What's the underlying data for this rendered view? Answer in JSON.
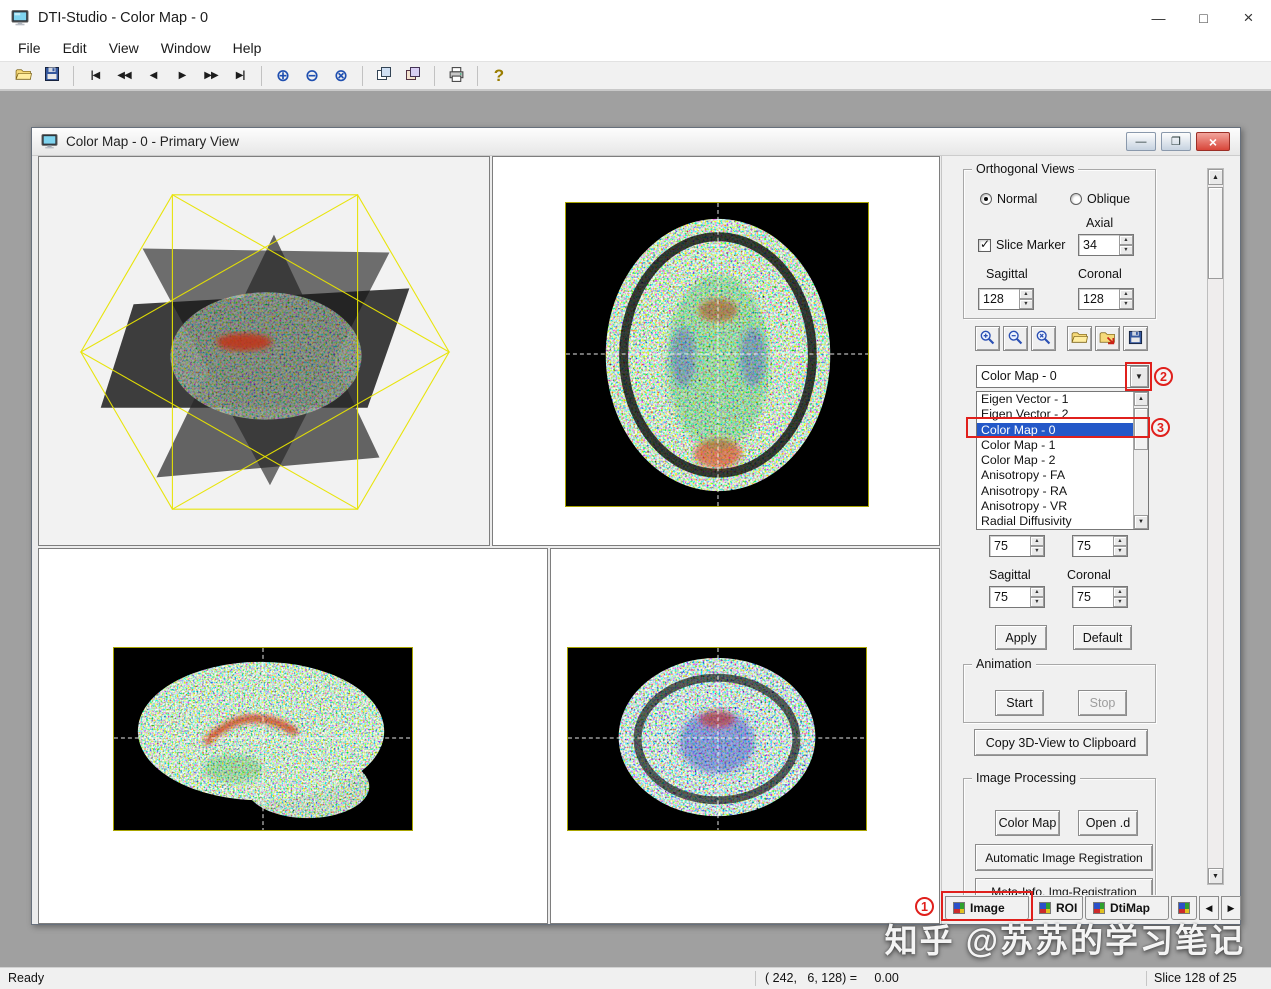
{
  "window": {
    "title": "DTI-Studio -  Color Map - 0",
    "controls": {
      "minimize": "—",
      "maximize": "□",
      "close": "×"
    }
  },
  "menu": {
    "items": [
      "File",
      "Edit",
      "View",
      "Window",
      "Help"
    ]
  },
  "child_window": {
    "title": "Color Map - 0 - Primary View",
    "controls": {
      "minimize": "—",
      "maximize": "❐",
      "close": "×"
    }
  },
  "panel": {
    "orthogonal": {
      "label": "Orthogonal Views",
      "normal": "Normal",
      "oblique": "Oblique",
      "axial_label": "Axial",
      "slice_marker": "Slice Marker",
      "axial_value": "34",
      "sagittal_label": "Sagittal",
      "coronal_label": "Coronal",
      "sagittal_value": "128",
      "coronal_value": "128"
    },
    "combo": {
      "value": "Color Map - 0"
    },
    "list": {
      "items": [
        "Eigen Vector - 1",
        "Eigen Vector - 2",
        "Color Map - 0",
        "Color Map - 1",
        "Color Map - 2",
        "Anisotropy - FA",
        "Anisotropy - RA",
        "Anisotropy - VR",
        "Radial Diffusivity"
      ],
      "selected_index": 2
    },
    "zoom": {
      "axial_a": "75",
      "axial_b": "75",
      "sagittal_label": "Sagittal",
      "coronal_label": "Coronal",
      "sagittal_value": "75",
      "coronal_value": "75",
      "apply": "Apply",
      "default": "Default"
    },
    "animation": {
      "label": "Animation",
      "start": "Start",
      "stop": "Stop"
    },
    "copy_3d": "Copy 3D-View to Clipboard",
    "image_processing": {
      "label": "Image Processing",
      "color_map": "Color Map",
      "open_d": "Open .d",
      "auto_registration": "Automatic Image Registration",
      "meta_info": "Meta-Info, Img-Registration"
    }
  },
  "tabs": {
    "items": [
      "Image",
      "ROI",
      "DtiMap"
    ]
  },
  "status": {
    "ready": "Ready",
    "coords": "( 242,   6, 128) =     0.00",
    "slice": "Slice 128 of 25"
  },
  "annotations": {
    "step1": "1",
    "step2": "2",
    "step3": "3"
  },
  "watermark": "知乎 @苏苏的学习笔记",
  "icons": {
    "app-icon": "monitor",
    "open-icon": "folder",
    "save-icon": "floppy-disk",
    "nav-first-icon": "|◀",
    "nav-prev-fast-icon": "◀◀",
    "nav-prev-icon": "◀",
    "nav-next-icon": "▶",
    "nav-next-fast-icon": "▶▶",
    "nav-last-icon": "▶|",
    "zoom-in-icon": "⊕",
    "zoom-out-icon": "⊖",
    "zoom-region-icon": "⊗",
    "copy-view-icon": "overlapping-windows",
    "duplicate-view-icon": "overlapping-windows",
    "print-icon": "printer",
    "help-icon": "?",
    "combo-arrow-icon": "▼",
    "spinner-up-icon": "▲",
    "spinner-down-icon": "▼",
    "tab-grid-icon": "colored-grid"
  },
  "colors": {
    "annotation": "#e0201c",
    "selection": "#2458c8",
    "close_button": "#d8463a",
    "mdi_background": "#a0a0a0"
  }
}
